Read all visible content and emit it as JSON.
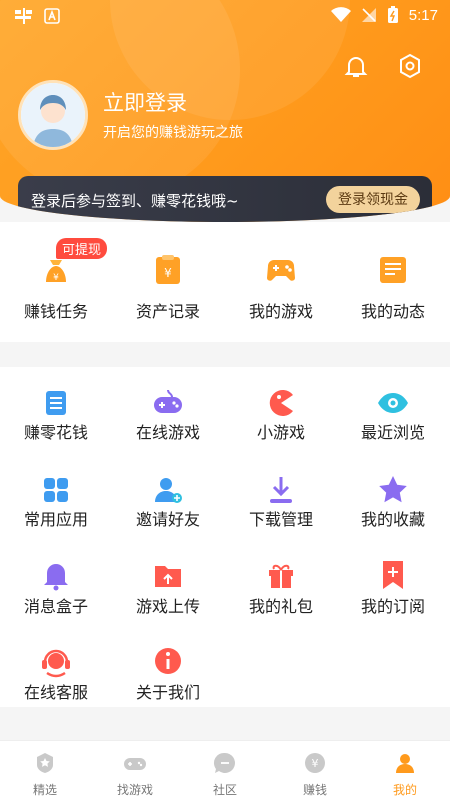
{
  "status_bar": {
    "time": "5:17"
  },
  "profile": {
    "title": "立即登录",
    "subtitle": "开启您的赚钱游玩之旅"
  },
  "banner": {
    "text": "登录后参与签到、赚零花钱哦~",
    "button": "登录领现金"
  },
  "quick_items": [
    {
      "label": "赚钱任务",
      "icon": "money-bag-icon",
      "badge": "可提现"
    },
    {
      "label": "资产记录",
      "icon": "asset-record-icon"
    },
    {
      "label": "我的游戏",
      "icon": "gamepad-icon"
    },
    {
      "label": "我的动态",
      "icon": "news-icon"
    }
  ],
  "grid_items": [
    {
      "label": "赚零花钱",
      "icon": "task-list-icon"
    },
    {
      "label": "在线游戏",
      "icon": "controller-icon"
    },
    {
      "label": "小游戏",
      "icon": "pacman-icon"
    },
    {
      "label": "最近浏览",
      "icon": "eye-icon"
    },
    {
      "label": "常用应用",
      "icon": "apps-icon"
    },
    {
      "label": "邀请好友",
      "icon": "invite-user-icon"
    },
    {
      "label": "下载管理",
      "icon": "download-icon"
    },
    {
      "label": "我的收藏",
      "icon": "star-icon"
    },
    {
      "label": "消息盒子",
      "icon": "bell-icon"
    },
    {
      "label": "游戏上传",
      "icon": "upload-folder-icon"
    },
    {
      "label": "我的礼包",
      "icon": "gift-icon"
    },
    {
      "label": "我的订阅",
      "icon": "bookmark-plus-icon"
    },
    {
      "label": "在线客服",
      "icon": "headset-icon"
    },
    {
      "label": "关于我们",
      "icon": "info-icon"
    }
  ],
  "bottom_nav": [
    {
      "label": "精选",
      "icon": "featured-icon"
    },
    {
      "label": "找游戏",
      "icon": "find-game-icon"
    },
    {
      "label": "社区",
      "icon": "community-icon"
    },
    {
      "label": "赚钱",
      "icon": "earn-icon"
    },
    {
      "label": "我的",
      "icon": "me-icon",
      "active": true
    }
  ],
  "colors": {
    "accent": "#ff9a1c",
    "badge": "#ff4b3e",
    "banner_bg": "#2f323d",
    "banner_btn": "#f3d39c"
  }
}
